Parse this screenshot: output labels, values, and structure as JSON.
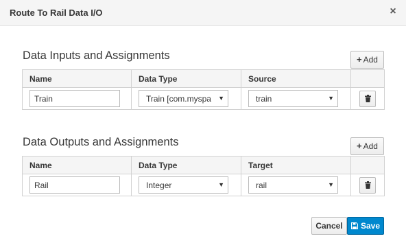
{
  "dialog": {
    "title": "Route To Rail Data I/O",
    "close_glyph": "×"
  },
  "inputs": {
    "section_title": "Data Inputs and Assignments",
    "add_label": "Add",
    "columns": [
      "Name",
      "Data Type",
      "Source"
    ],
    "rows": [
      {
        "name": "Train",
        "data_type": "Train [com.myspa",
        "source": "train"
      }
    ]
  },
  "outputs": {
    "section_title": "Data Outputs and Assignments",
    "add_label": "Add",
    "columns": [
      "Name",
      "Data Type",
      "Target"
    ],
    "rows": [
      {
        "name": "Rail",
        "data_type": "Integer",
        "target": "rail"
      }
    ]
  },
  "footer": {
    "cancel_label": "Cancel",
    "save_label": "Save"
  },
  "colors": {
    "primary": "#0088ce",
    "header_bg": "#f5f5f5"
  },
  "icons": [
    "close-icon",
    "plus-icon",
    "trash-icon",
    "caret-down-icon",
    "save-icon"
  ]
}
